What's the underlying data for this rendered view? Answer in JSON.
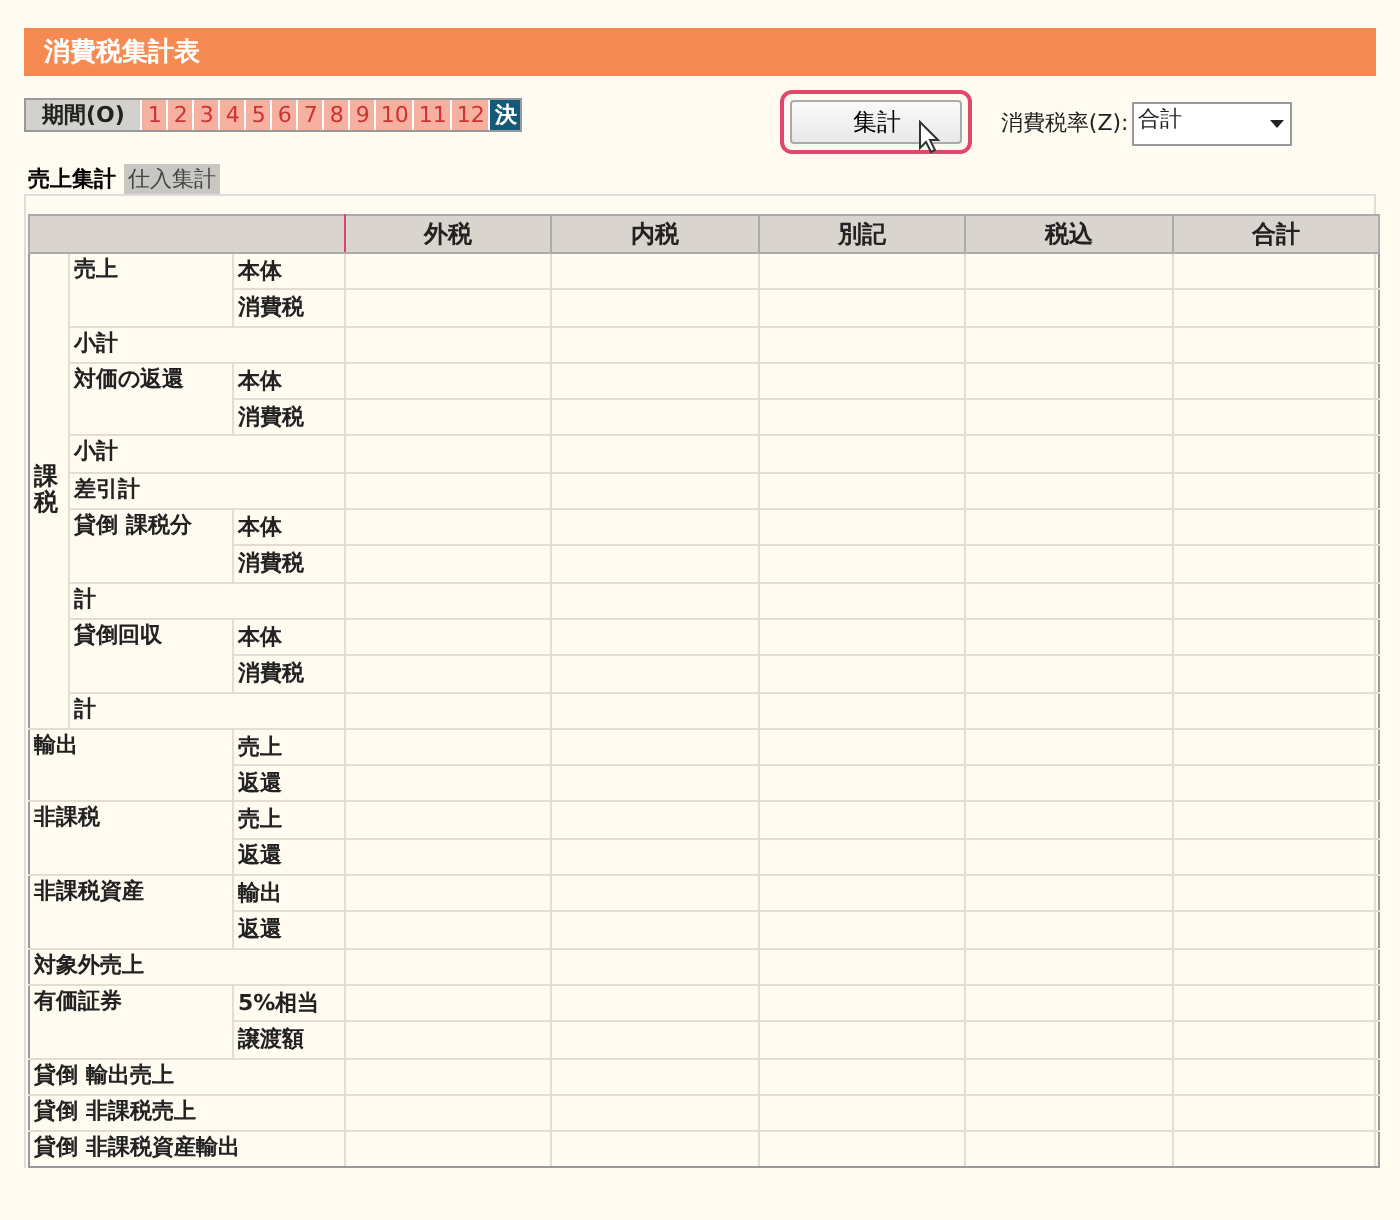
{
  "title": "消費税集計表",
  "period": {
    "label": "期間(O)",
    "items": [
      {
        "label": "1",
        "selected": false
      },
      {
        "label": "2",
        "selected": false
      },
      {
        "label": "3",
        "selected": false
      },
      {
        "label": "4",
        "selected": false
      },
      {
        "label": "5",
        "selected": false
      },
      {
        "label": "6",
        "selected": false
      },
      {
        "label": "7",
        "selected": false
      },
      {
        "label": "8",
        "selected": false
      },
      {
        "label": "9",
        "selected": false
      },
      {
        "label": "10",
        "selected": false
      },
      {
        "label": "11",
        "selected": false
      },
      {
        "label": "12",
        "selected": false
      },
      {
        "label": "決",
        "selected": true
      }
    ]
  },
  "aggregate_button": {
    "label": "集計",
    "focused": true
  },
  "tax_rate": {
    "label": "消費税率(Z):",
    "value": "合計"
  },
  "tabs": [
    {
      "label": "売上集計",
      "selected": true
    },
    {
      "label": "仕入集計",
      "selected": false
    }
  ],
  "table": {
    "columns": [
      "外税",
      "内税",
      "別記",
      "税込",
      "合計"
    ],
    "row_groups": [
      {
        "label": "課税",
        "items": [
          {
            "label": "売上",
            "subs": [
              "本体",
              "消費税"
            ]
          },
          {
            "label": "小計"
          },
          {
            "label": "対価の返還",
            "subs": [
              "本体",
              "消費税"
            ]
          },
          {
            "label": "小計"
          },
          {
            "label": "差引計"
          },
          {
            "label": "貸倒 課税分",
            "subs": [
              "本体",
              "消費税"
            ]
          },
          {
            "label": "計"
          },
          {
            "label": "貸倒回収",
            "subs": [
              "本体",
              "消費税"
            ]
          },
          {
            "label": "計"
          }
        ]
      },
      {
        "label": "輸出",
        "subs": [
          "売上",
          "返還"
        ]
      },
      {
        "label": "非課税",
        "subs": [
          "売上",
          "返還"
        ]
      },
      {
        "label": "非課税資産",
        "subs": [
          "輸出",
          "返還"
        ]
      },
      {
        "label": "対象外売上"
      },
      {
        "label": "有価証券",
        "subs": [
          "5%相当",
          "譲渡額"
        ]
      },
      {
        "label": "貸倒 輸出売上"
      },
      {
        "label": "貸倒 非課税売上"
      },
      {
        "label": "貸倒 非課税資産輸出"
      }
    ]
  }
}
